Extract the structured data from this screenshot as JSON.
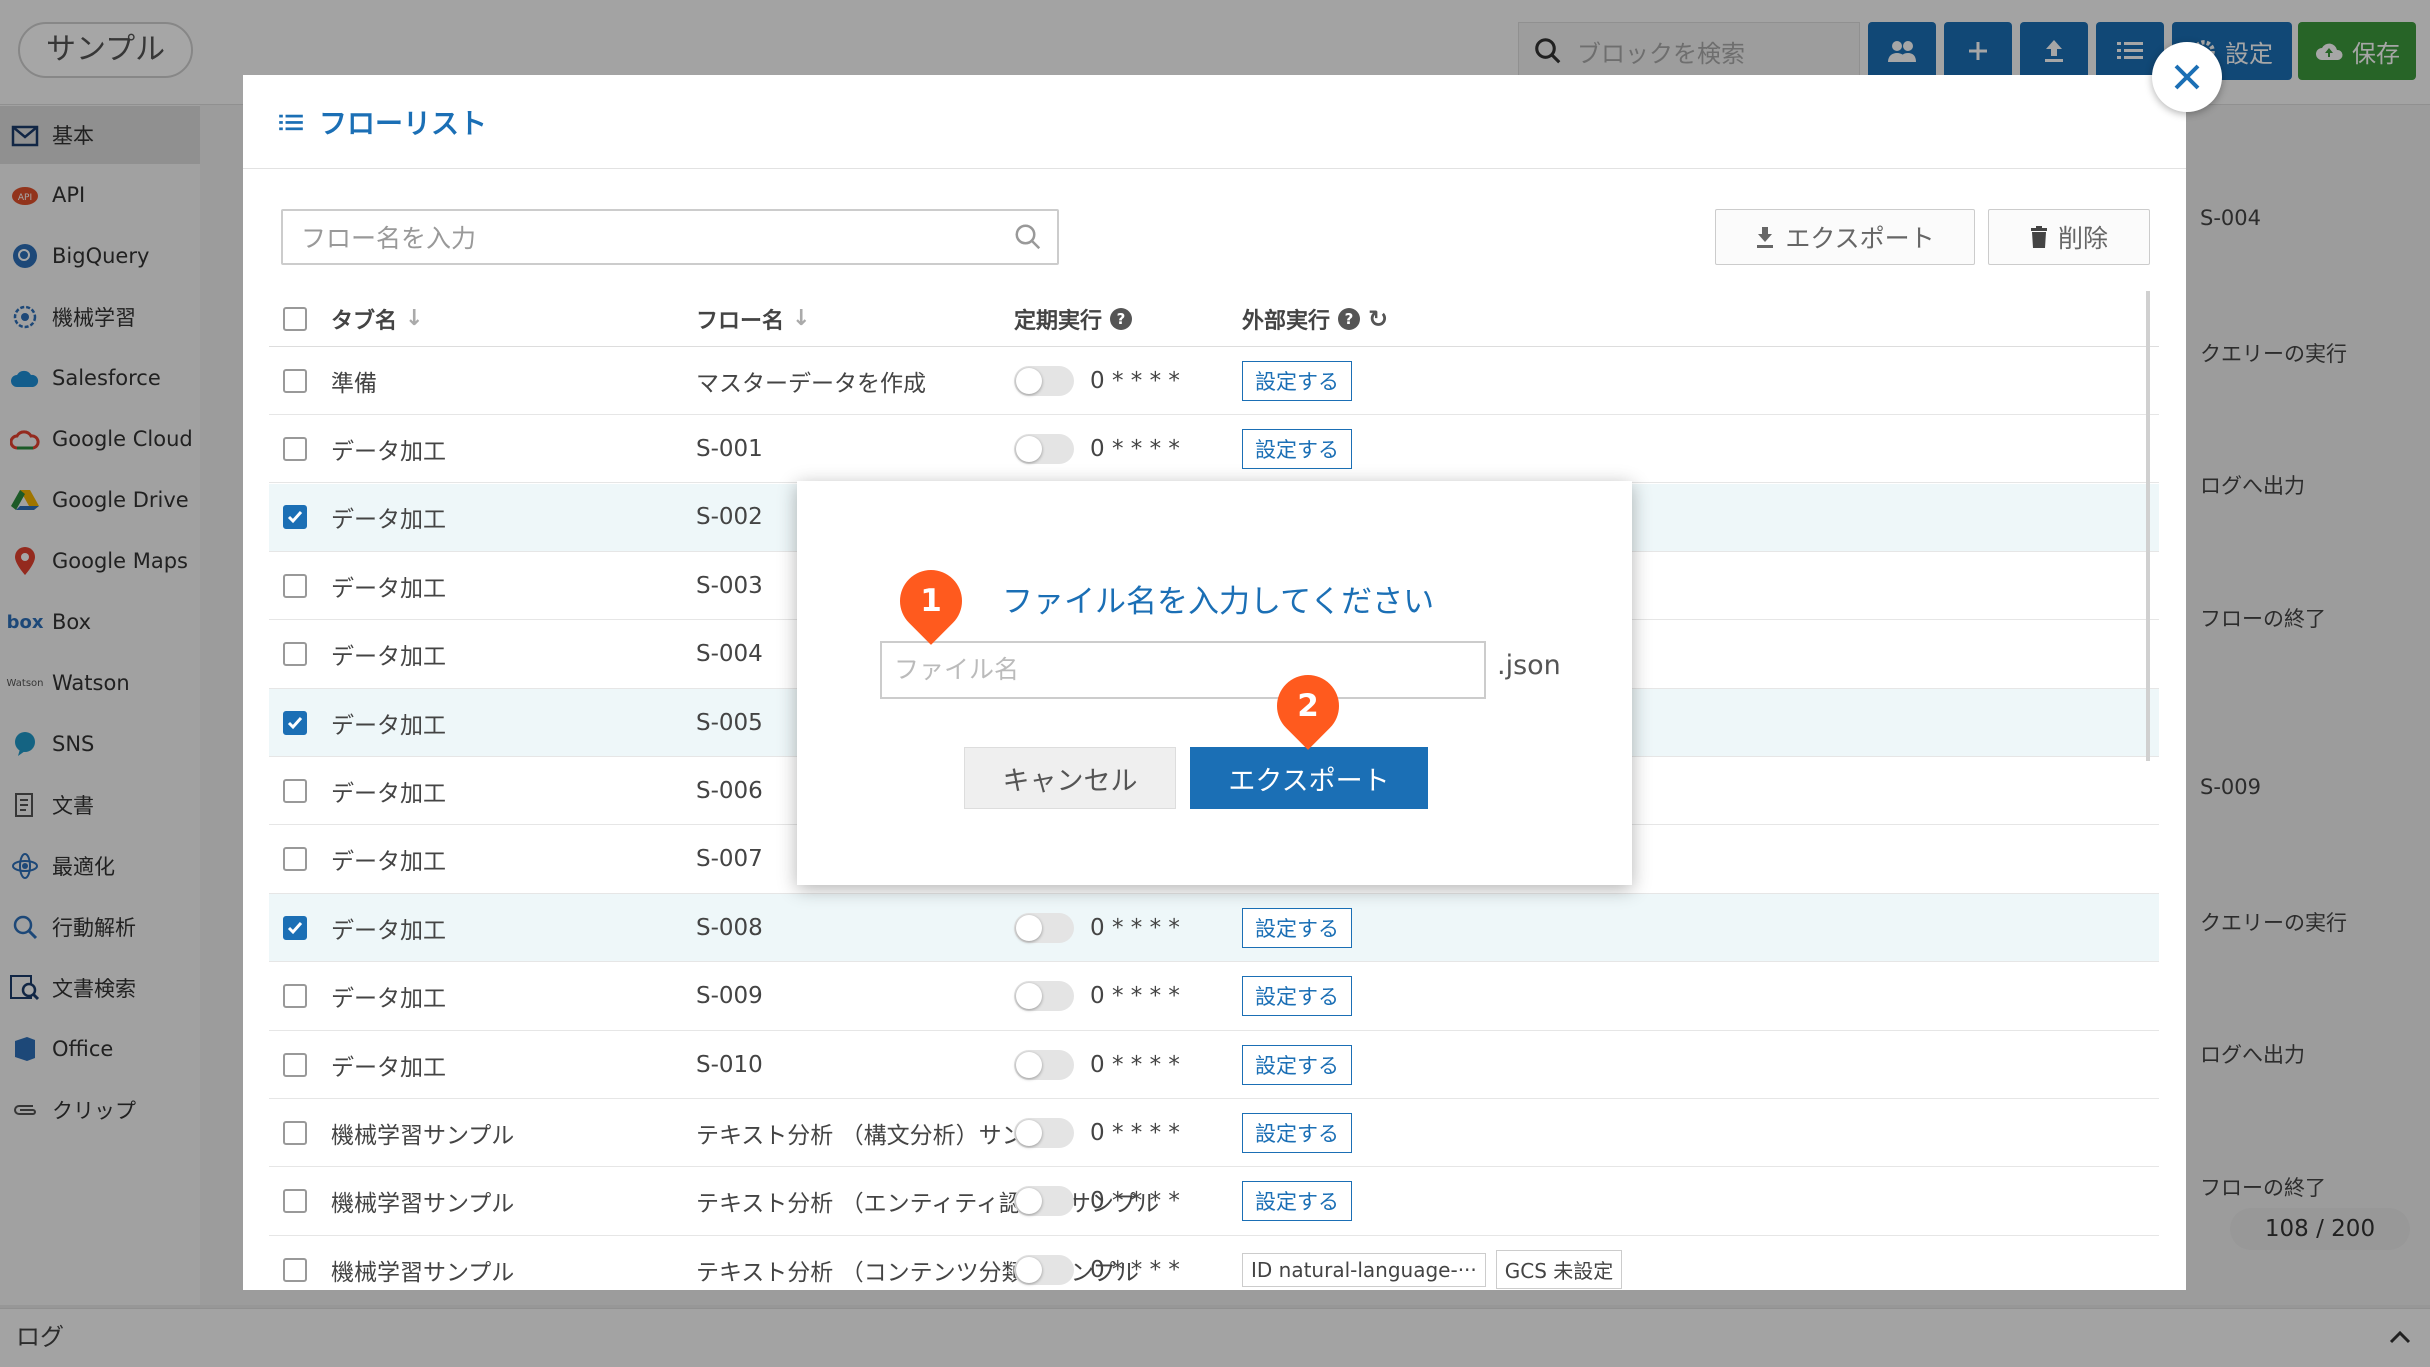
{
  "app": {
    "title": "サンプル",
    "block_search_placeholder": "ブロックを検索",
    "settings_label": "設定",
    "save_label": "保存",
    "log_label": "ログ",
    "counter": "108 / 200"
  },
  "sidebar": {
    "items": [
      {
        "label": "基本",
        "icon": "puzzle-icon"
      },
      {
        "label": "API",
        "icon": "api-icon"
      },
      {
        "label": "BigQuery",
        "icon": "bigquery-icon"
      },
      {
        "label": "機械学習",
        "icon": "brain-icon"
      },
      {
        "label": "Salesforce",
        "icon": "salesforce-icon"
      },
      {
        "label": "Google Cloud",
        "icon": "google-cloud-icon"
      },
      {
        "label": "Google Drive",
        "icon": "google-drive-icon"
      },
      {
        "label": "Google Maps",
        "icon": "map-pin-icon"
      },
      {
        "label": "Box",
        "icon": "box-icon"
      },
      {
        "label": "Watson",
        "icon": "watson-icon"
      },
      {
        "label": "SNS",
        "icon": "chat-icon"
      },
      {
        "label": "文書",
        "icon": "document-icon"
      },
      {
        "label": "最適化",
        "icon": "atom-icon"
      },
      {
        "label": "行動解析",
        "icon": "behavior-icon"
      },
      {
        "label": "文書検索",
        "icon": "doc-search-icon"
      },
      {
        "label": "Office",
        "icon": "office-icon"
      },
      {
        "label": "クリップ",
        "icon": "clip-icon"
      }
    ]
  },
  "canvas": {
    "nodes": [
      "S-004",
      "クエリーの実行",
      "ログへ出力",
      "フローの終了",
      "S-009",
      "クエリーの実行",
      "ログへ出力",
      "フローの終了"
    ]
  },
  "flow_list": {
    "title": "フローリスト",
    "search_placeholder": "フロー名を入力",
    "export_label": "エクスポート",
    "delete_label": "削除",
    "columns": {
      "tab_name": "タブ名",
      "flow_name": "フロー名",
      "schedule": "定期実行",
      "external": "外部実行"
    },
    "set_label": "設定する",
    "rows": [
      {
        "tab": "準備",
        "flow": "マスターデータを作成",
        "cron": "0 * * * *",
        "checked": false
      },
      {
        "tab": "データ加工",
        "flow": "S-001",
        "cron": "0 * * * *",
        "checked": false
      },
      {
        "tab": "データ加工",
        "flow": "S-002",
        "cron": "",
        "checked": true
      },
      {
        "tab": "データ加工",
        "flow": "S-003",
        "cron": "",
        "checked": false
      },
      {
        "tab": "データ加工",
        "flow": "S-004",
        "cron": "",
        "checked": false
      },
      {
        "tab": "データ加工",
        "flow": "S-005",
        "cron": "",
        "checked": true
      },
      {
        "tab": "データ加工",
        "flow": "S-006",
        "cron": "",
        "checked": false
      },
      {
        "tab": "データ加工",
        "flow": "S-007",
        "cron": "",
        "checked": false
      },
      {
        "tab": "データ加工",
        "flow": "S-008",
        "cron": "0 * * * *",
        "checked": true
      },
      {
        "tab": "データ加工",
        "flow": "S-009",
        "cron": "0 * * * *",
        "checked": false
      },
      {
        "tab": "データ加工",
        "flow": "S-010",
        "cron": "0 * * * *",
        "checked": false
      },
      {
        "tab": "機械学習サンプル",
        "flow": "テキスト分析 （構文分析）サンプル",
        "cron": "0 * * * *",
        "checked": false
      },
      {
        "tab": "機械学習サンプル",
        "flow": "テキスト分析 （エンティティ認識）サンプル",
        "cron": "0 * * * *",
        "checked": false
      },
      {
        "tab": "機械学習サンプル",
        "flow": "テキスト分析 （コンテンツ分類）サンプル",
        "cron": "0 * * * *",
        "checked": false
      }
    ],
    "last_row_id": "ID natural-language-···",
    "last_row_gcs": "GCS 未設定"
  },
  "dialog": {
    "title": "ファイル名を入力してください",
    "input_placeholder": "ファイル名",
    "extension": ".json",
    "cancel_label": "キャンセル",
    "export_label": "エクスポート",
    "step1": "1",
    "step2": "2"
  },
  "colors": {
    "primary": "#1b6fb5",
    "save_green": "#3c9a3c",
    "marker_orange": "#ff5a1e"
  }
}
